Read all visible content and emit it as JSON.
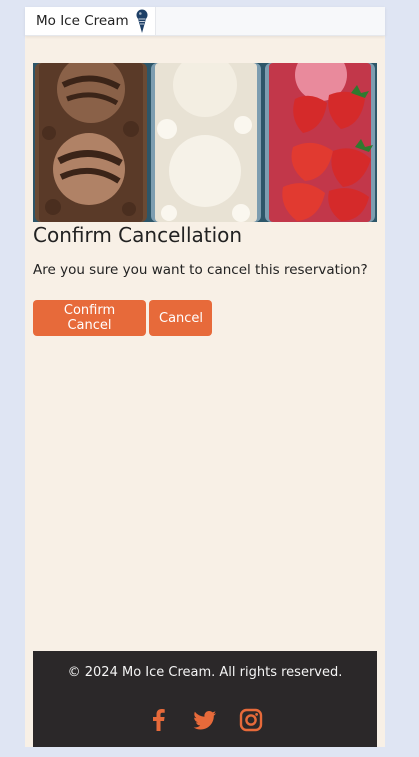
{
  "header": {
    "brand": "Mo Ice Cream",
    "brand_icon": "ice-cream-cone-icon"
  },
  "hero": {
    "image": "ice cream tubs: chocolate, vanilla, strawberry"
  },
  "dialog": {
    "title": "Confirm Cancellation",
    "message": "Are you sure you want to cancel this reservation?",
    "confirm_label": "Confirm Cancel",
    "cancel_label": "Cancel"
  },
  "footer": {
    "copyright": "© 2024 Mo Ice Cream. All rights reserved.",
    "social": [
      "facebook-icon",
      "twitter-icon",
      "instagram-icon"
    ]
  },
  "colors": {
    "accent": "#e76a3a",
    "page_bg": "#f8f0e6",
    "footer_bg": "#2b2829",
    "outer_bg": "#dfe5f3"
  }
}
